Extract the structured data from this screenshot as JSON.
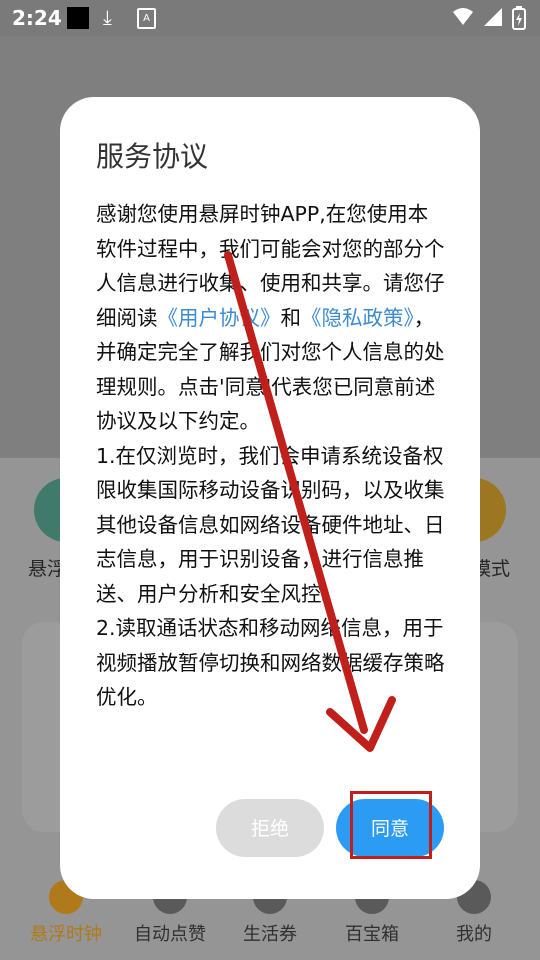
{
  "status_bar": {
    "time": "2:24",
    "download_icon": "download-icon",
    "a_badge": "A"
  },
  "app": {
    "features": [
      {
        "label": "悬浮"
      },
      {
        "label": "模式"
      }
    ],
    "bottom_nav": [
      {
        "label": "悬浮时钟",
        "active": true
      },
      {
        "label": "自动点赞"
      },
      {
        "label": "生活券"
      },
      {
        "label": "百宝箱"
      },
      {
        "label": "我的"
      }
    ]
  },
  "dialog": {
    "title": "服务协议",
    "intro_1": "感谢您使用悬屏时钟APP,在您使用本软件过程中，我们可能会对您的部分个人信息进行收集、使用和共享。请您仔细阅读",
    "link_user_agreement": "《用户协议》",
    "and": "和",
    "link_privacy_policy": "《隐私政策》",
    "intro_2": "，并确定完全了解我们对您个人信息的处理规则。点击'同意'代表您已同意前述协议及以下约定。",
    "item_1": "1.在仅浏览时，我们会申请系统设备权限收集国际移动设备识别码，以及收集其他设备信息如网络设备硬件地址、日志信息，用于识别设备，进行信息推送、用户分析和安全风控。",
    "item_2": "2.读取通话状态和移动网络信息，用于视频播放暂停切换和网络数据缓存策略优化。",
    "reject_label": "拒绝",
    "agree_label": "同意"
  },
  "colors": {
    "agree": "#2b9bf4",
    "reject": "#dcdcdc",
    "link": "#3f8bd0",
    "annotation": "#c0201c"
  }
}
